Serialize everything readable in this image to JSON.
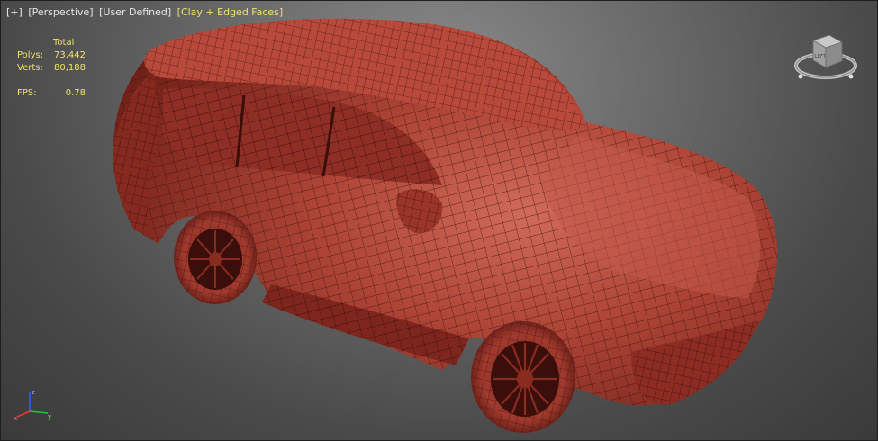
{
  "viewport": {
    "labels": [
      "[+]",
      "[Perspective]",
      "[User Defined]",
      "[Clay + Edged Faces]"
    ],
    "label_color": "#e6e6e6",
    "active_label_color": "#f0e070"
  },
  "stats": {
    "total_label": "Total",
    "polys_label": "Polys:",
    "polys_value": "73,442",
    "verts_label": "Verts:",
    "verts_value": "80,188",
    "fps_label": "FPS:",
    "fps_value": "0.78",
    "text_color": "#f0e070"
  },
  "viewcube": {
    "face_label": "LEFT"
  },
  "axis_tripod": {
    "x": "x",
    "y": "y",
    "z": "z"
  },
  "model": {
    "shading": "clay",
    "clay_color": "#a5392e",
    "wire_color": "#3a0f0b"
  }
}
